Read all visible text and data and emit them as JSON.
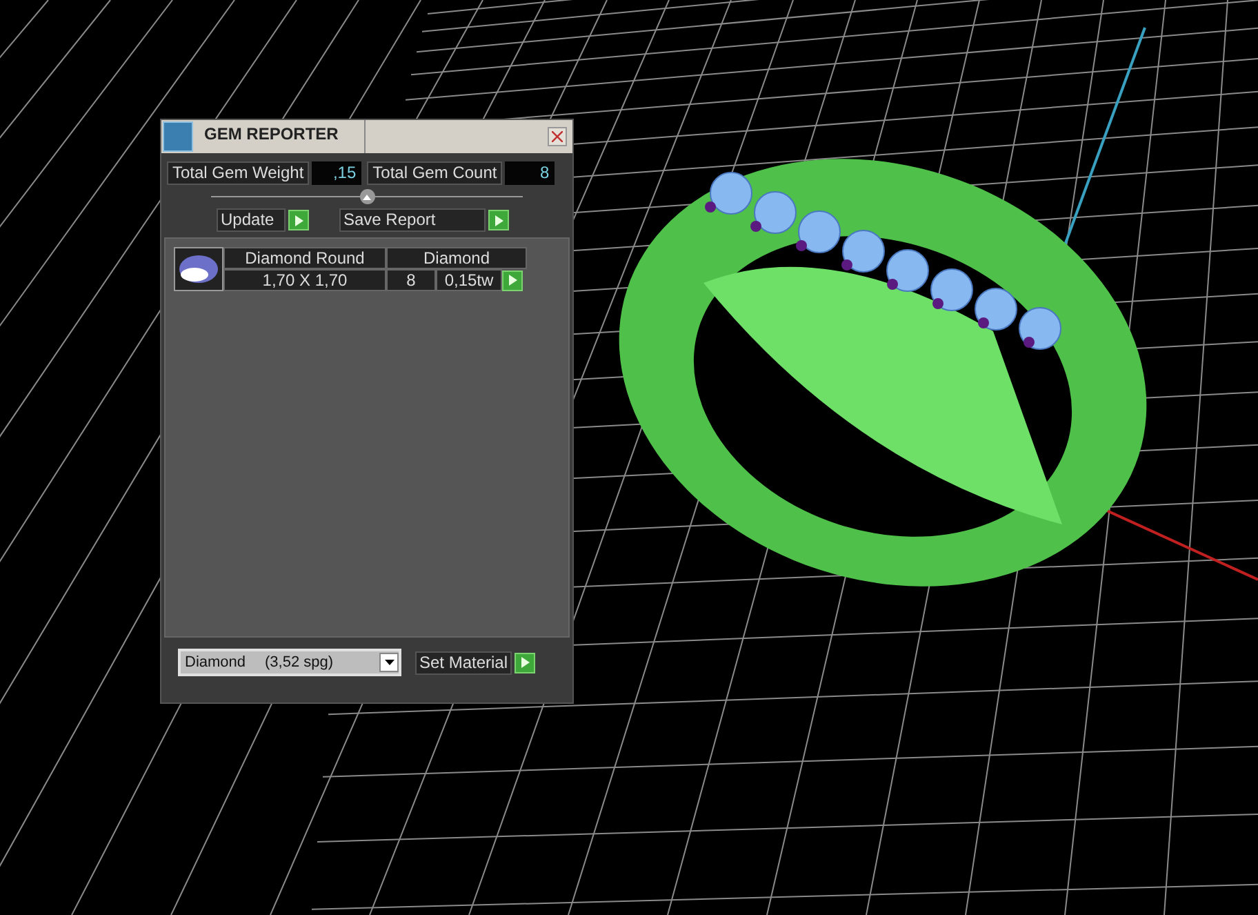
{
  "window": {
    "title": "GEM REPORTER"
  },
  "summary": [
    {
      "label": "Total Gem Weight",
      "value": ",15"
    },
    {
      "label": "Total Gem Count",
      "value": "8"
    }
  ],
  "buttons": [
    {
      "label": "Update"
    },
    {
      "label": "Save Report"
    }
  ],
  "gems": [
    {
      "name": "Diamond Round",
      "material": "Diamond",
      "size": "1,70 X 1,70",
      "count": "8",
      "weight": "0,15tw"
    }
  ],
  "material_select": {
    "name": "Diamond",
    "density": "(3,52 spg)"
  },
  "set_material_button": {
    "label": "Set Material"
  }
}
